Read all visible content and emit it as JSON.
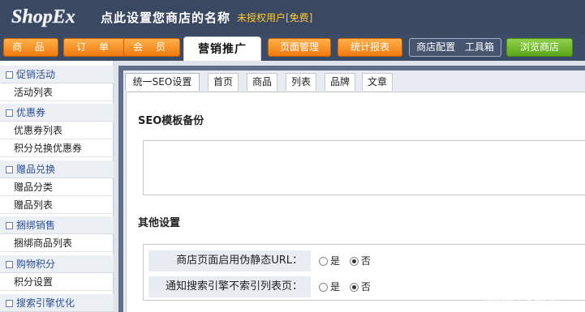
{
  "header": {
    "logo_text": "ShopEx",
    "shop_name": "点此设置您商店的名称",
    "license": "未授权用户[免费]"
  },
  "nav": {
    "items": [
      "商 品",
      "订 单",
      "会 员",
      "营销推广",
      "页面管理",
      "统计报表",
      "商店配置 工具箱",
      "浏览商店"
    ],
    "active": "营销推广"
  },
  "sidebar": {
    "groups": [
      {
        "title": "促销活动",
        "items": [
          "活动列表"
        ]
      },
      {
        "title": "优惠券",
        "items": [
          "优惠券列表",
          "积分兑换优惠券"
        ]
      },
      {
        "title": "赠品兑换",
        "items": [
          "赠品分类",
          "赠品列表"
        ]
      },
      {
        "title": "捆绑销售",
        "items": [
          "捆绑商品列表"
        ]
      },
      {
        "title": "购物积分",
        "items": [
          "积分设置"
        ]
      },
      {
        "title": "搜索引擎优化",
        "items": []
      }
    ]
  },
  "tabs": [
    "统一SEO设置",
    "首页",
    "商品",
    "列表",
    "品牌",
    "文章"
  ],
  "panel": {
    "backup_title": "SEO模板备份",
    "other_title": "其他设置",
    "rows": [
      {
        "label": "商店页面启用伪静态URL：",
        "yes": "是",
        "no": "否",
        "selected": "否"
      },
      {
        "label": "通知搜索引擎不索引列表页：",
        "yes": "是",
        "no": "否",
        "selected": "否"
      }
    ]
  },
  "watermark": "头条号 / 木桶seo"
}
